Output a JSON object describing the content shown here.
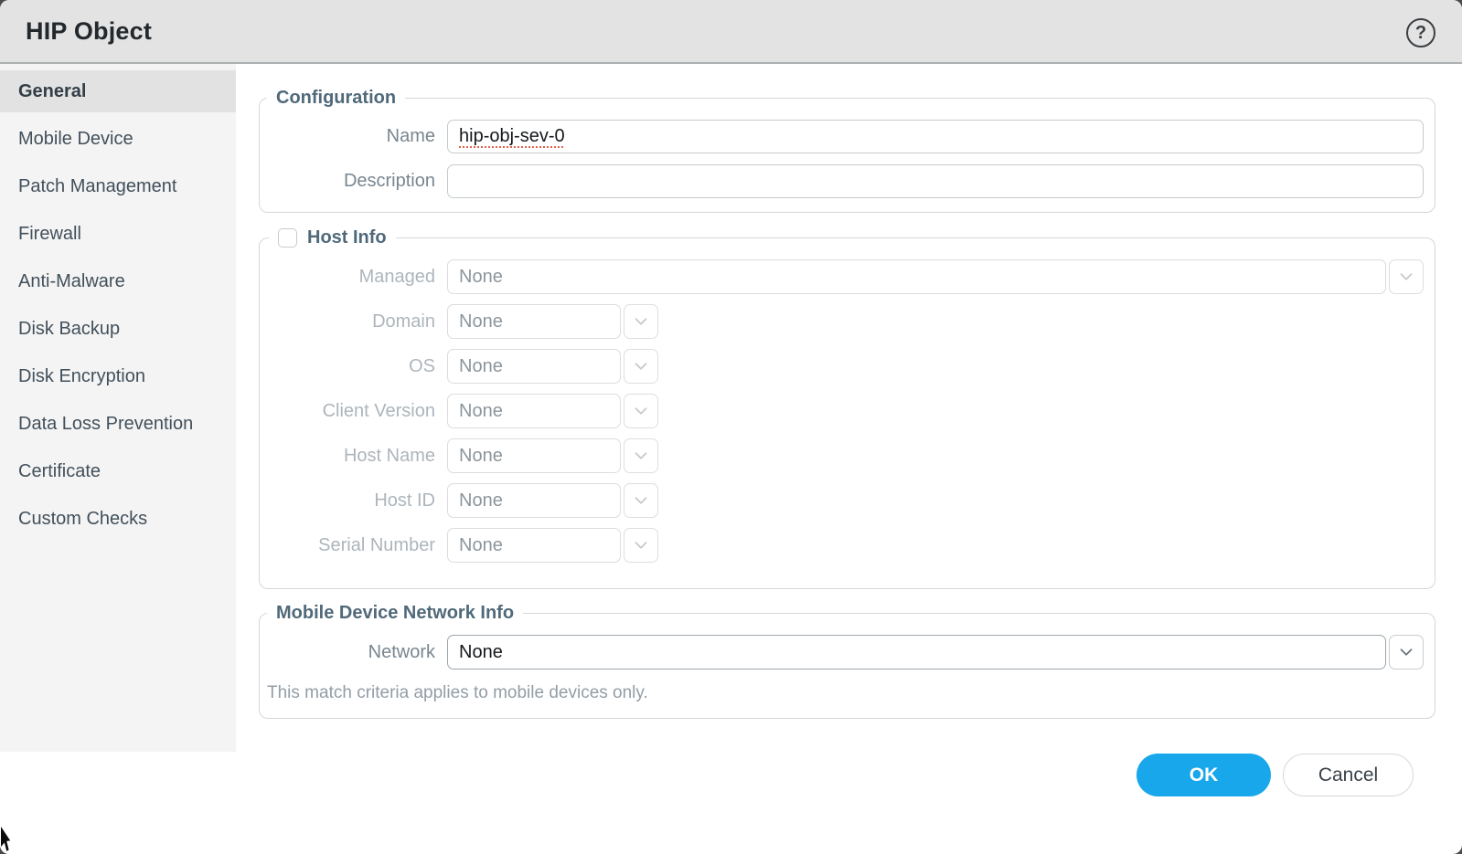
{
  "window": {
    "title": "HIP Object",
    "help_glyph": "?"
  },
  "sidebar": {
    "items": [
      {
        "label": "General",
        "selected": true
      },
      {
        "label": "Mobile Device",
        "selected": false
      },
      {
        "label": "Patch Management",
        "selected": false
      },
      {
        "label": "Firewall",
        "selected": false
      },
      {
        "label": "Anti-Malware",
        "selected": false
      },
      {
        "label": "Disk Backup",
        "selected": false
      },
      {
        "label": "Disk Encryption",
        "selected": false
      },
      {
        "label": "Data Loss Prevention",
        "selected": false
      },
      {
        "label": "Certificate",
        "selected": false
      },
      {
        "label": "Custom Checks",
        "selected": false
      }
    ]
  },
  "configuration": {
    "legend": "Configuration",
    "name_label": "Name",
    "name_value": "hip-obj-sev-0",
    "description_label": "Description",
    "description_value": ""
  },
  "host_info": {
    "legend": "Host Info",
    "checkbox_checked": false,
    "rows": [
      {
        "label": "Managed",
        "value": "None",
        "size": "full",
        "state": "disabled"
      },
      {
        "label": "Domain",
        "value": "None",
        "size": "small",
        "state": "disabled"
      },
      {
        "label": "OS",
        "value": "None",
        "size": "small",
        "state": "disabled"
      },
      {
        "label": "Client Version",
        "value": "None",
        "size": "small",
        "state": "disabled"
      },
      {
        "label": "Host Name",
        "value": "None",
        "size": "small",
        "state": "disabled"
      },
      {
        "label": "Host ID",
        "value": "None",
        "size": "small",
        "state": "disabled"
      },
      {
        "label": "Serial Number",
        "value": "None",
        "size": "small",
        "state": "disabled"
      }
    ]
  },
  "mobile_network": {
    "legend": "Mobile Device Network Info",
    "network_label": "Network",
    "network_value": "None",
    "note": "This match criteria applies to mobile devices only."
  },
  "footer": {
    "ok_label": "OK",
    "cancel_label": "Cancel"
  },
  "colors": {
    "ok_button_blue": "#18a7ea",
    "titlebar_gray": "#e3e3e3",
    "sidebar_gray": "#f4f4f4",
    "selected_tab_gray": "#e2e2e2",
    "legend_slate": "#50697a",
    "disabled_text": "#adb5bb",
    "spellcheck_red": "#e4604f"
  }
}
